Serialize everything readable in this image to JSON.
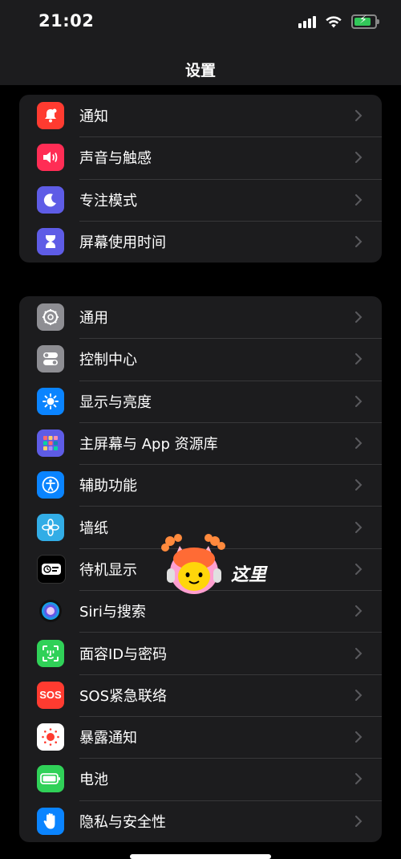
{
  "status_bar": {
    "time": "21:02"
  },
  "nav": {
    "title": "设置"
  },
  "groups": [
    {
      "items": [
        {
          "label": "通知",
          "icon": "bell-icon",
          "color": "#ff3b30"
        },
        {
          "label": "声音与触感",
          "icon": "speaker-icon",
          "color": "#ff2d55"
        },
        {
          "label": "专注模式",
          "icon": "moon-icon",
          "color": "#5e5ce6"
        },
        {
          "label": "屏幕使用时间",
          "icon": "hourglass-icon",
          "color": "#5e5ce6"
        }
      ]
    },
    {
      "items": [
        {
          "label": "通用",
          "icon": "gear-icon",
          "color": "#8e8e93"
        },
        {
          "label": "控制中心",
          "icon": "toggles-icon",
          "color": "#8e8e93"
        },
        {
          "label": "显示与亮度",
          "icon": "sun-icon",
          "color": "#0a84ff"
        },
        {
          "label": "主屏幕与 App 资源库",
          "icon": "app-grid-icon",
          "color": "#5e5ce6"
        },
        {
          "label": "辅助功能",
          "icon": "accessibility-icon",
          "color": "#0a84ff"
        },
        {
          "label": "墙纸",
          "icon": "flower-icon",
          "color": "#32ade6"
        },
        {
          "label": "待机显示",
          "icon": "standby-icon",
          "color": "#000000"
        },
        {
          "label": "Siri与搜索",
          "icon": "siri-icon",
          "color": "#1c1c1e"
        },
        {
          "label": "面容ID与密码",
          "icon": "face-id-icon",
          "color": "#30d158"
        },
        {
          "label": "SOS紧急联络",
          "icon": "sos-icon",
          "color": "#ff3b30"
        },
        {
          "label": "暴露通知",
          "icon": "exposure-icon",
          "color": "#ffffff"
        },
        {
          "label": "电池",
          "icon": "battery-icon",
          "color": "#30d158"
        },
        {
          "label": "隐私与安全性",
          "icon": "hand-icon",
          "color": "#0a84ff"
        }
      ]
    }
  ],
  "overlay": {
    "text": "这里",
    "icon": "mascot-sticker-icon"
  }
}
